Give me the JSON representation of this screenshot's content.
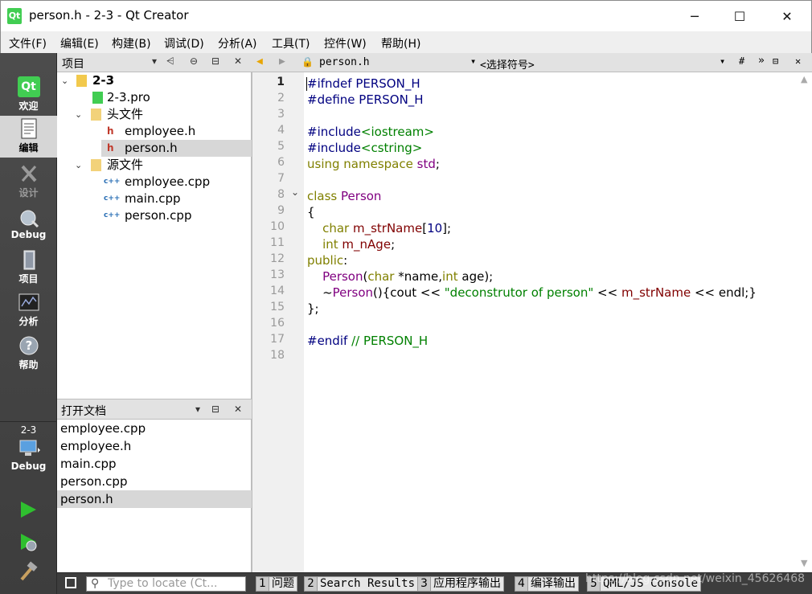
{
  "window": {
    "title": "person.h - 2-3 - Qt Creator",
    "min_glyph": "─",
    "max_glyph": "☐",
    "close_glyph": "✕"
  },
  "menu": [
    "文件(F)",
    "编辑(E)",
    "构建(B)",
    "调试(D)",
    "分析(A)",
    "工具(T)",
    "控件(W)",
    "帮助(H)"
  ],
  "modes": {
    "welcome": "欢迎",
    "edit": "编辑",
    "design": "设计",
    "debug": "Debug",
    "projects": "项目",
    "analyze": "分析",
    "help": "帮助",
    "kit_project": "2-3",
    "kit_config": "Debug"
  },
  "project_panel": {
    "header": "项目",
    "tree": [
      {
        "label": "2-3",
        "icon": "qt-project-icon"
      },
      {
        "label": "2-3.pro",
        "icon": "pro-file-icon"
      },
      {
        "label": "头文件",
        "icon": "header-folder-icon"
      },
      {
        "label": "employee.h",
        "icon": "header-file-icon"
      },
      {
        "label": "person.h",
        "icon": "header-file-icon",
        "selected": true
      },
      {
        "label": "源文件",
        "icon": "source-folder-icon"
      },
      {
        "label": "employee.cpp",
        "icon": "cpp-file-icon"
      },
      {
        "label": "main.cpp",
        "icon": "cpp-file-icon"
      },
      {
        "label": "person.cpp",
        "icon": "cpp-file-icon"
      }
    ]
  },
  "open_docs": {
    "header": "打开文档",
    "items": [
      "employee.cpp",
      "employee.h",
      "main.cpp",
      "person.cpp",
      "person.h"
    ],
    "selected": "person.h"
  },
  "editor": {
    "file": "person.h",
    "symbol": "<选择符号>",
    "line_numbers": [
      "1",
      "2",
      "3",
      "4",
      "5",
      "6",
      "7",
      "8",
      "9",
      "10",
      "11",
      "12",
      "13",
      "14",
      "15",
      "16",
      "17",
      "18"
    ],
    "current_line": "1",
    "fold_marker": "⌄"
  },
  "statusbar": {
    "locate_placeholder": "Type to locate (Ct...",
    "panes": [
      {
        "num": "1",
        "label": "问题"
      },
      {
        "num": "2",
        "label": "Search Results"
      },
      {
        "num": "3",
        "label": "应用程序输出"
      },
      {
        "num": "4",
        "label": "编译输出"
      },
      {
        "num": "5",
        "label": "QML/JS Console"
      }
    ],
    "watermark": "https://blog.csdn.net/weixin_45626468"
  },
  "colors": {
    "accent_qt_green": "#41cd52",
    "preprocessor": "#000080",
    "keyword": "#808000",
    "type": "#800080",
    "string": "#008000",
    "member": "#800000"
  }
}
